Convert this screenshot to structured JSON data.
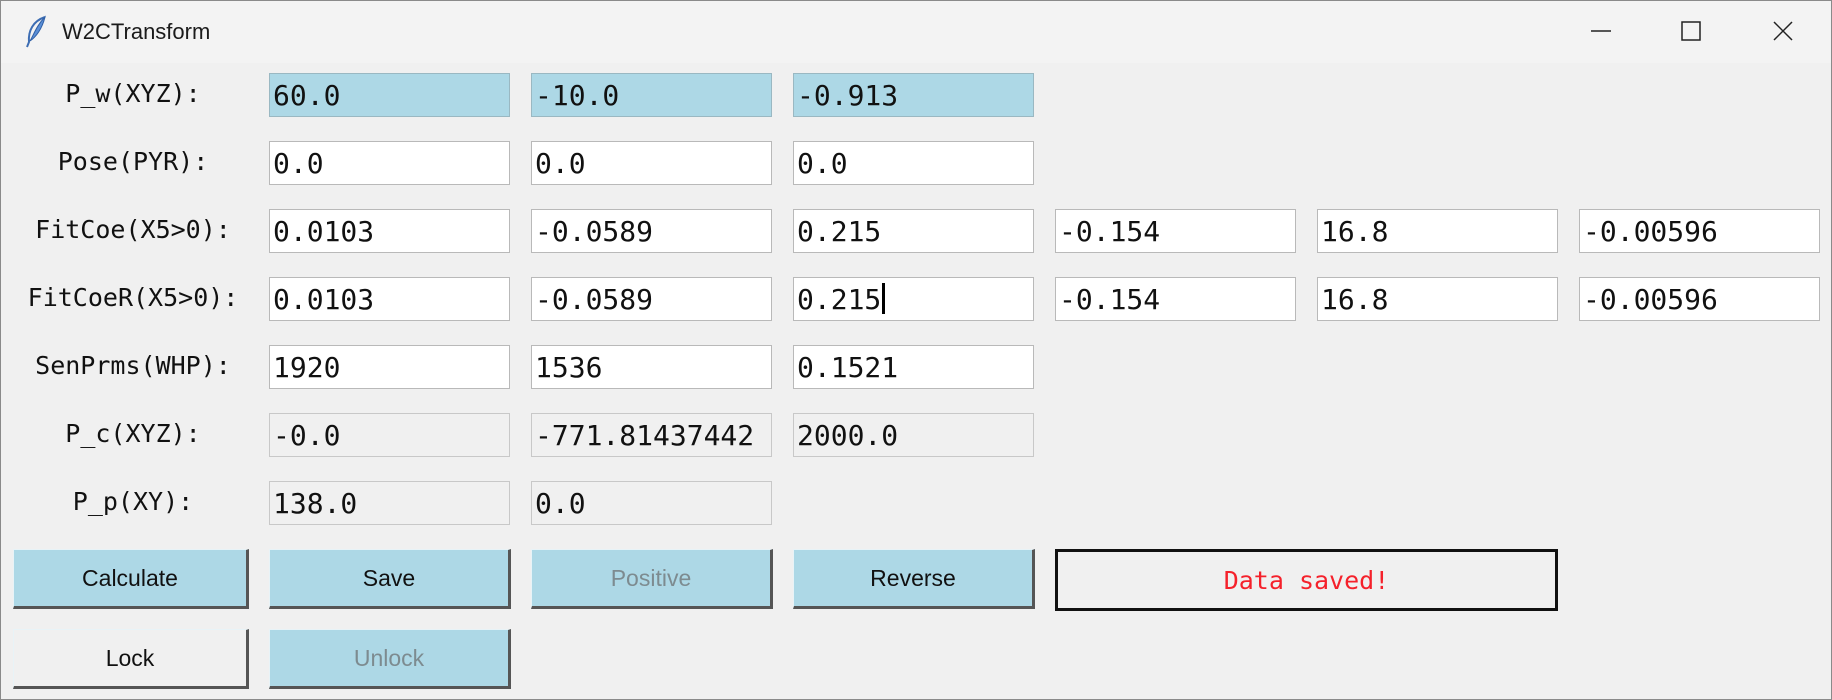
{
  "window": {
    "title": "W2CTransform"
  },
  "rows": {
    "pw": {
      "label": "P_w(XYZ):",
      "values": [
        "60.0",
        "-10.0",
        "-0.913"
      ]
    },
    "pose": {
      "label": "Pose(PYR):",
      "values": [
        "0.0",
        "0.0",
        "0.0"
      ]
    },
    "fitcoe": {
      "label": "FitCoe(X5>0):",
      "values": [
        "0.0103",
        "-0.0589",
        "0.215",
        "-0.154",
        "16.8",
        "-0.00596"
      ]
    },
    "fitcoer": {
      "label": "FitCoeR(X5>0):",
      "values": [
        "0.0103",
        "-0.0589",
        "0.215",
        "-0.154",
        "16.8",
        "-0.00596"
      ]
    },
    "senprms": {
      "label": "SenPrms(WHP):",
      "values": [
        "1920",
        "1536",
        "0.1521"
      ]
    },
    "pc": {
      "label": "P_c(XYZ):",
      "values": [
        "-0.0",
        "-771.81437442",
        "2000.0"
      ]
    },
    "pp": {
      "label": "P_p(XY):",
      "values": [
        "138.0",
        "0.0"
      ]
    }
  },
  "buttons": {
    "calculate": "Calculate",
    "save": "Save",
    "positive": "Positive",
    "reverse": "Reverse",
    "lock": "Lock",
    "unlock": "Unlock"
  },
  "status": {
    "message": "Data saved!"
  },
  "colors": {
    "highlight": "#add8e6",
    "status_text": "#f5212b",
    "background": "#f0f0f0"
  },
  "icons": {
    "app": "feather-icon",
    "minimize": "minimize-icon",
    "maximize": "maximize-icon",
    "close": "close-icon"
  }
}
